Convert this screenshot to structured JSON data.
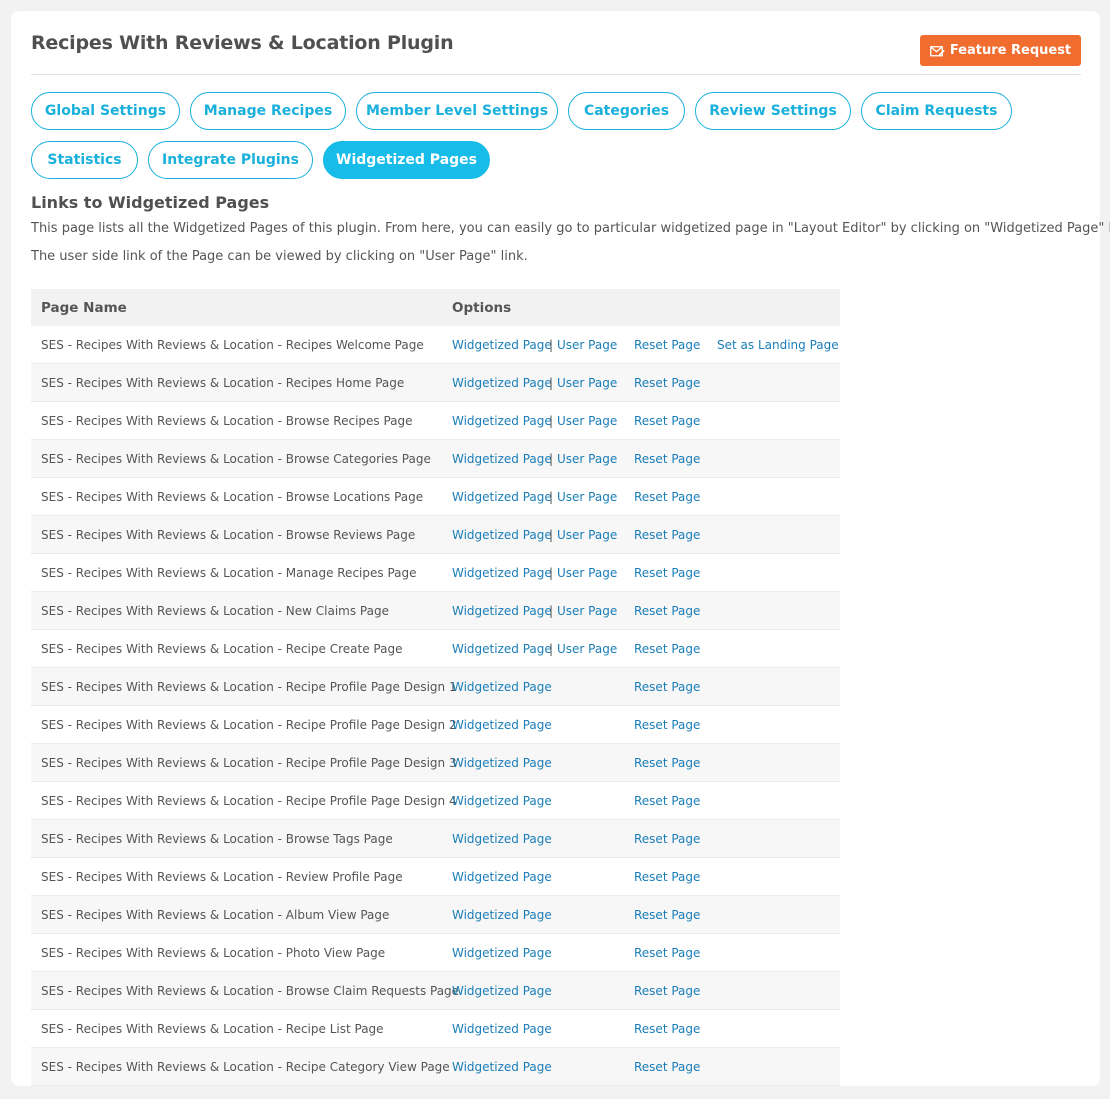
{
  "header": {
    "title": "Recipes With Reviews & Location Plugin",
    "feature_request_label": "Feature Request",
    "feature_request_icon": "envelope-edit-icon",
    "accent_color": "#f16d2f"
  },
  "tabs": [
    {
      "label": "Global Settings",
      "active": false
    },
    {
      "label": "Manage Recipes",
      "active": false
    },
    {
      "label": "Member Level Settings",
      "active": false
    },
    {
      "label": "Categories",
      "active": false
    },
    {
      "label": "Review Settings",
      "active": false
    },
    {
      "label": "Claim Requests",
      "active": false
    },
    {
      "label": "Statistics",
      "active": false
    },
    {
      "label": "Integrate Plugins",
      "active": false
    },
    {
      "label": "Widgetized Pages",
      "active": true
    }
  ],
  "tab_color": "#1ab0dc",
  "section": {
    "title": "Links to Widgetized Pages",
    "description_line1": "This page lists all the Widgetized Pages of this plugin. From here, you can easily go to particular widgetized page in \"Layout Editor\" by clicking on \"Widgetized Page\" link.",
    "description_line2": "The user side link of the Page can be viewed by clicking on \"User Page\" link."
  },
  "table": {
    "columns": [
      "Page Name",
      "Options"
    ],
    "link_labels": {
      "widgetized": "Widgetized Page",
      "separator": "|",
      "user": "User Page",
      "reset": "Reset Page",
      "landing": "Set as Landing Page"
    },
    "rows": [
      {
        "name": "SES - Recipes With Reviews & Location - Recipes Welcome Page",
        "user_page": true,
        "landing": true
      },
      {
        "name": "SES - Recipes With Reviews & Location - Recipes Home Page",
        "user_page": true,
        "landing": false
      },
      {
        "name": "SES - Recipes With Reviews & Location - Browse Recipes Page",
        "user_page": true,
        "landing": false
      },
      {
        "name": "SES - Recipes With Reviews & Location - Browse Categories Page",
        "user_page": true,
        "landing": false
      },
      {
        "name": "SES - Recipes With Reviews & Location - Browse Locations Page",
        "user_page": true,
        "landing": false
      },
      {
        "name": "SES - Recipes With Reviews & Location - Browse Reviews Page",
        "user_page": true,
        "landing": false
      },
      {
        "name": "SES - Recipes With Reviews & Location - Manage Recipes Page",
        "user_page": true,
        "landing": false
      },
      {
        "name": "SES - Recipes With Reviews & Location - New Claims Page",
        "user_page": true,
        "landing": false
      },
      {
        "name": "SES - Recipes With Reviews & Location - Recipe Create Page",
        "user_page": true,
        "landing": false
      },
      {
        "name": "SES - Recipes With Reviews & Location - Recipe Profile Page Design 1",
        "user_page": false,
        "landing": false
      },
      {
        "name": "SES - Recipes With Reviews & Location - Recipe Profile Page Design 2",
        "user_page": false,
        "landing": false
      },
      {
        "name": "SES - Recipes With Reviews & Location - Recipe Profile Page Design 3",
        "user_page": false,
        "landing": false
      },
      {
        "name": "SES - Recipes With Reviews & Location - Recipe Profile Page Design 4",
        "user_page": false,
        "landing": false
      },
      {
        "name": "SES - Recipes With Reviews & Location - Browse Tags Page",
        "user_page": false,
        "landing": false
      },
      {
        "name": "SES - Recipes With Reviews & Location - Review Profile Page",
        "user_page": false,
        "landing": false
      },
      {
        "name": "SES - Recipes With Reviews & Location - Album View Page",
        "user_page": false,
        "landing": false
      },
      {
        "name": "SES - Recipes With Reviews & Location - Photo View Page",
        "user_page": false,
        "landing": false
      },
      {
        "name": "SES - Recipes With Reviews & Location - Browse Claim Requests Page",
        "user_page": false,
        "landing": false
      },
      {
        "name": "SES - Recipes With Reviews & Location - Recipe List Page",
        "user_page": false,
        "landing": false
      },
      {
        "name": "SES - Recipes With Reviews & Location - Recipe Category View Page",
        "user_page": false,
        "landing": false
      }
    ]
  }
}
